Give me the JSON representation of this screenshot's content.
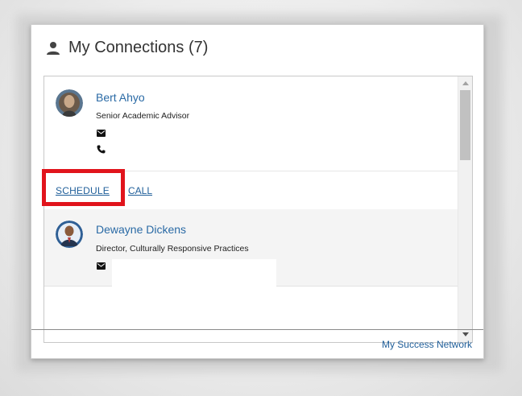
{
  "card": {
    "title": "My Connections (7)",
    "title_icon": "person-icon"
  },
  "connections": [
    {
      "name": "Bert Ahyo",
      "role": "Senior Academic Advisor",
      "icons": [
        "mail-icon",
        "phone-icon"
      ],
      "actions": {
        "schedule": "SCHEDULE",
        "call": "CALL"
      }
    },
    {
      "name": "Dewayne Dickens",
      "role": "Director, Culturally Responsive Practices",
      "icons": [
        "mail-icon"
      ]
    }
  ],
  "footer": {
    "link": "My Success Network"
  },
  "colors": {
    "link": "#2a6aa5",
    "highlight": "#e1141c",
    "title": "#333333"
  }
}
